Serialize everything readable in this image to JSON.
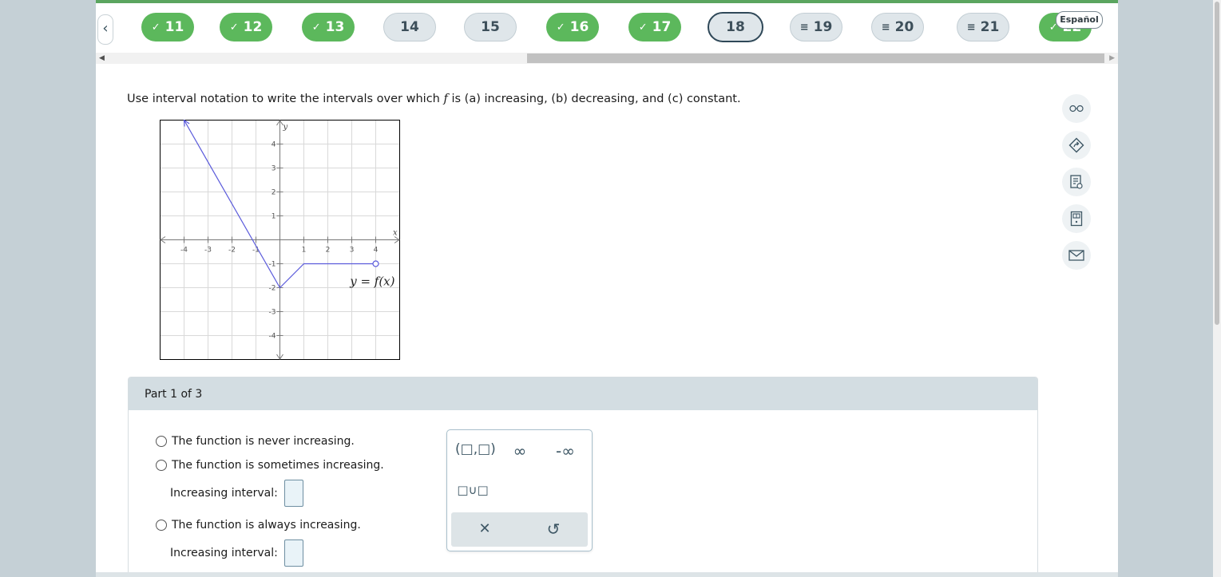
{
  "nav": {
    "prev_icon": "chevron-left-icon",
    "items": [
      {
        "label": "11",
        "state": "done",
        "icon": "check-icon",
        "glyph": "✓"
      },
      {
        "label": "12",
        "state": "done",
        "icon": "check-icon",
        "glyph": "✓"
      },
      {
        "label": "13",
        "state": "done",
        "icon": "check-icon",
        "glyph": "✓"
      },
      {
        "label": "14",
        "state": "todo",
        "icon": "",
        "glyph": ""
      },
      {
        "label": "15",
        "state": "todo",
        "icon": "",
        "glyph": ""
      },
      {
        "label": "16",
        "state": "done",
        "icon": "check-icon",
        "glyph": "✓"
      },
      {
        "label": "17",
        "state": "done",
        "icon": "check-icon",
        "glyph": "✓"
      },
      {
        "label": "18",
        "state": "current",
        "icon": "",
        "glyph": ""
      },
      {
        "label": "19",
        "state": "started",
        "icon": "lines-icon",
        "glyph": "≡"
      },
      {
        "label": "20",
        "state": "started",
        "icon": "lines-icon",
        "glyph": "≡"
      },
      {
        "label": "21",
        "state": "started",
        "icon": "lines-icon",
        "glyph": "≡"
      },
      {
        "label": "22",
        "state": "done",
        "icon": "check-icon",
        "glyph": "✓"
      }
    ],
    "language_label": "Español",
    "done_color": "#5cb85c",
    "topbar_color": "#5ba55f"
  },
  "question": {
    "prefix": "Use interval notation to write the intervals over which ",
    "fvar": "f",
    "suffix": " is (a) increasing, (b) decreasing, and (c) constant."
  },
  "graph": {
    "x_axis_label": "x",
    "y_axis_label": "y",
    "curve_label": "y = f(x)",
    "x_ticks": [
      "-4",
      "-3",
      "-2",
      "-1",
      "1",
      "2",
      "3",
      "4"
    ],
    "y_ticks": [
      "4",
      "3",
      "2",
      "1",
      "-1",
      "-2",
      "-3",
      "-4"
    ],
    "xlim": [
      -5,
      5
    ],
    "ylim": [
      -5,
      5
    ],
    "line_color": "#5b5bdb",
    "vertices": [
      [
        -4,
        5
      ],
      [
        0,
        -2
      ],
      [
        1,
        -1
      ],
      [
        4,
        -1
      ]
    ],
    "arrow_at_start": true,
    "open_circle_at_end": true
  },
  "tools": [
    "glasses-icon",
    "share-icon",
    "notes-icon",
    "calculator-icon",
    "mail-icon"
  ],
  "part": {
    "title": "Part 1 of 3",
    "options": [
      {
        "text": "The function is never increasing."
      },
      {
        "text": "The function is sometimes increasing.",
        "interval_label": "Increasing interval:"
      },
      {
        "text": "The function is always increasing.",
        "interval_label": "Increasing interval:"
      }
    ]
  },
  "palette": {
    "interval_template": "(□,□)",
    "infinity": "∞",
    "neg_infinity": "-∞",
    "union_template": "□∪□",
    "clear_icon": "close-icon",
    "clear_glyph": "✕",
    "undo_icon": "undo-icon",
    "undo_glyph": "↺"
  }
}
